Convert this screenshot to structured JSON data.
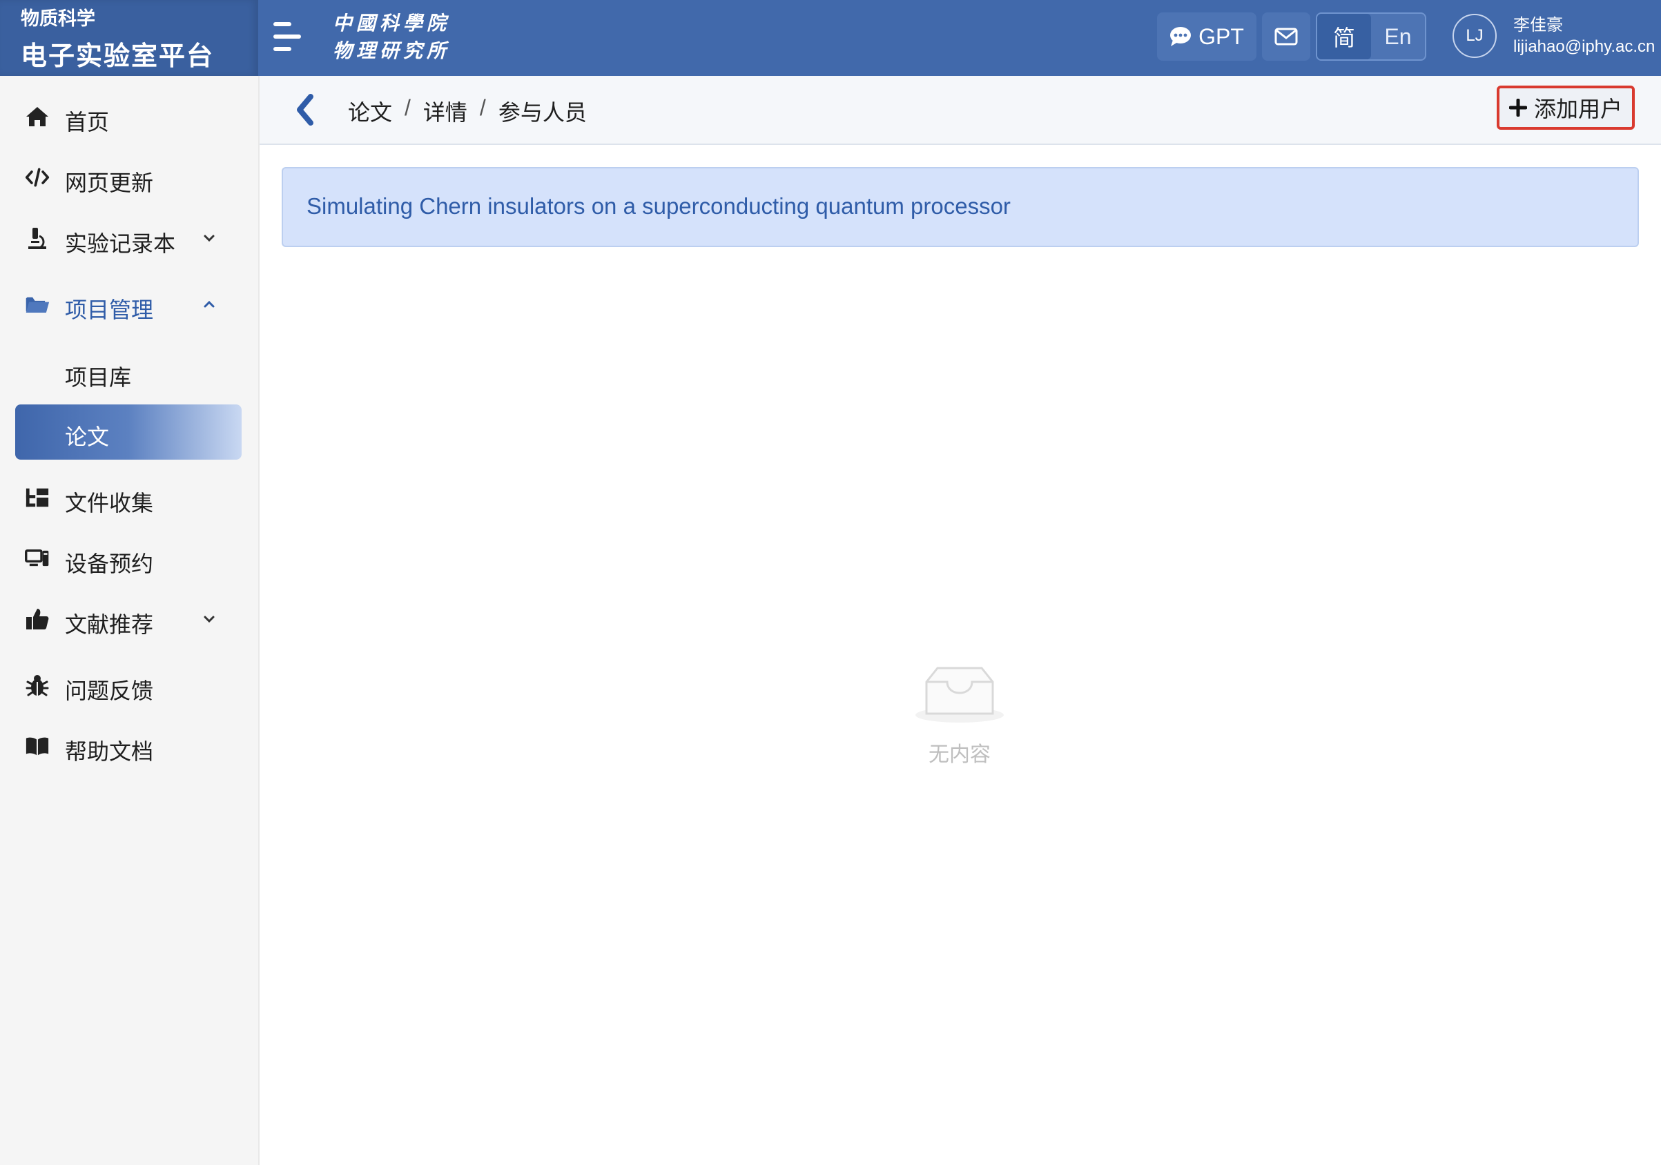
{
  "brand": {
    "subtitle": "物质科学",
    "title": "电子实验室平台"
  },
  "institute_logo": {
    "line1": "中國科學院",
    "line2": "物理研究所"
  },
  "header": {
    "gpt_label": "GPT",
    "lang": {
      "zh": "简",
      "en": "En",
      "active": "zh"
    },
    "user": {
      "initials": "LJ",
      "name": "李佳豪",
      "email": "lijiahao@iphy.ac.cn"
    },
    "icons": {
      "menu": "hamburger-icon",
      "chat": "chat-bubble-icon",
      "mail": "mail-icon"
    }
  },
  "sidebar": {
    "items": [
      {
        "label": "首页",
        "icon": "home-icon"
      },
      {
        "label": "网页更新",
        "icon": "code-icon"
      },
      {
        "label": "实验记录本",
        "icon": "microscope-icon",
        "expandable": true,
        "expanded": false
      },
      {
        "label": "项目管理",
        "icon": "folder-icon",
        "expandable": true,
        "expanded": true,
        "children": [
          {
            "label": "项目库",
            "active": false
          },
          {
            "label": "论文",
            "active": true
          }
        ]
      },
      {
        "label": "文件收集",
        "icon": "tree-icon"
      },
      {
        "label": "设备预约",
        "icon": "device-icon"
      },
      {
        "label": "文献推荐",
        "icon": "thumbs-up-icon",
        "expandable": true,
        "expanded": false
      },
      {
        "label": "问题反馈",
        "icon": "bug-icon"
      },
      {
        "label": "帮助文档",
        "icon": "book-icon"
      }
    ]
  },
  "breadcrumb": [
    "论文",
    "详情",
    "参与人员"
  ],
  "breadcrumb_separator": "/",
  "actions": {
    "add_user": "添加用户"
  },
  "paper_title": "Simulating Chern insulators on a superconducting quantum processor",
  "empty_state": {
    "text": "无内容",
    "icon": "empty-inbox-icon"
  },
  "colors": {
    "header": "#4169ab",
    "brand": "#3a609f",
    "accent": "#2f5ca8",
    "banner": "#d5e2fb",
    "highlight": "#d93a2f"
  }
}
